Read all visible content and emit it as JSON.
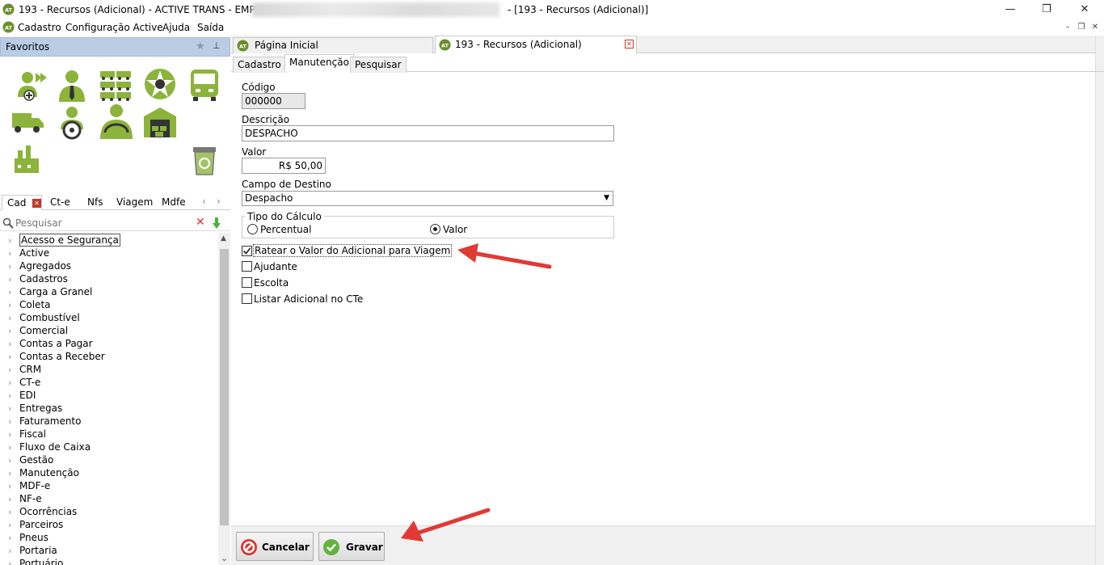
{
  "window": {
    "title_prefix": "193 - Recursos (Adicional) - ACTIVE TRANS - EMPRESA:",
    "title_suffix": "- [193 - Recursos (Adicional)]",
    "minimize": "—",
    "maximize": "❒",
    "close": "✕"
  },
  "menu": {
    "items": [
      "Cadastro",
      "Configuração Active",
      "Ajuda",
      "Saída"
    ],
    "mdi_minimize": "–",
    "mdi_restore": "❐",
    "mdi_close": "✕"
  },
  "favorites": {
    "title": "Favoritos",
    "icons": [
      "add-driver-icon",
      "person-tie-icon",
      "truck-fleet-icon",
      "steering-star-icon",
      "bus-front-icon",
      "small-truck-icon",
      "driver-wheel-icon",
      "driver-seat-icon",
      "warehouse-icon",
      "factory-icon",
      "recycle-bin-icon"
    ]
  },
  "left_tabs": [
    "Cad",
    "Ct-e",
    "Nfs",
    "Viagem",
    "Mdfe"
  ],
  "search": {
    "placeholder": "Pesquisar"
  },
  "tree": {
    "items": [
      "Acesso e Segurança",
      "Active",
      "Agregados",
      "Cadastros",
      "Carga a Granel",
      "Coleta",
      "Combustível",
      "Comercial",
      "Contas a Pagar",
      "Contas a Receber",
      "CRM",
      "CT-e",
      "EDI",
      "Entregas",
      "Faturamento",
      "Fiscal",
      "Fluxo de Caixa",
      "Gestão",
      "Manutenção",
      "MDF-e",
      "NF-e",
      "Ocorrências",
      "Parceiros",
      "Pneus",
      "Portaria",
      "Portuário"
    ]
  },
  "doc_tabs": {
    "home": "Página Inicial",
    "active": "193 - Recursos (Adicional)"
  },
  "sub_tabs": [
    "Cadastro",
    "Manutenção",
    "Pesquisar"
  ],
  "form": {
    "codigo_label": "Código",
    "codigo_value": "000000",
    "descricao_label": "Descrição",
    "descricao_value": "DESPACHO",
    "valor_label": "Valor",
    "valor_value": "R$ 50,00",
    "destino_label": "Campo de Destino",
    "destino_value": "Despacho",
    "tipo_label": "Tipo do Cálculo",
    "radio_percentual": "Percentual",
    "radio_valor": "Valor",
    "radio_selected": "Valor",
    "chk_ratear": "Ratear o Valor do Adicional para Viagem",
    "chk_ratear_checked": true,
    "chk_ajudante": "Ajudante",
    "chk_escolta": "Escolta",
    "chk_listar": "Listar Adicional no CTe"
  },
  "buttons": {
    "cancel": "Cancelar",
    "save": "Gravar"
  },
  "colors": {
    "accent_green": "#8cb33b",
    "fav_header": "#b9cde5",
    "arrow_red": "#e03a35",
    "close_red": "#c0392b"
  }
}
